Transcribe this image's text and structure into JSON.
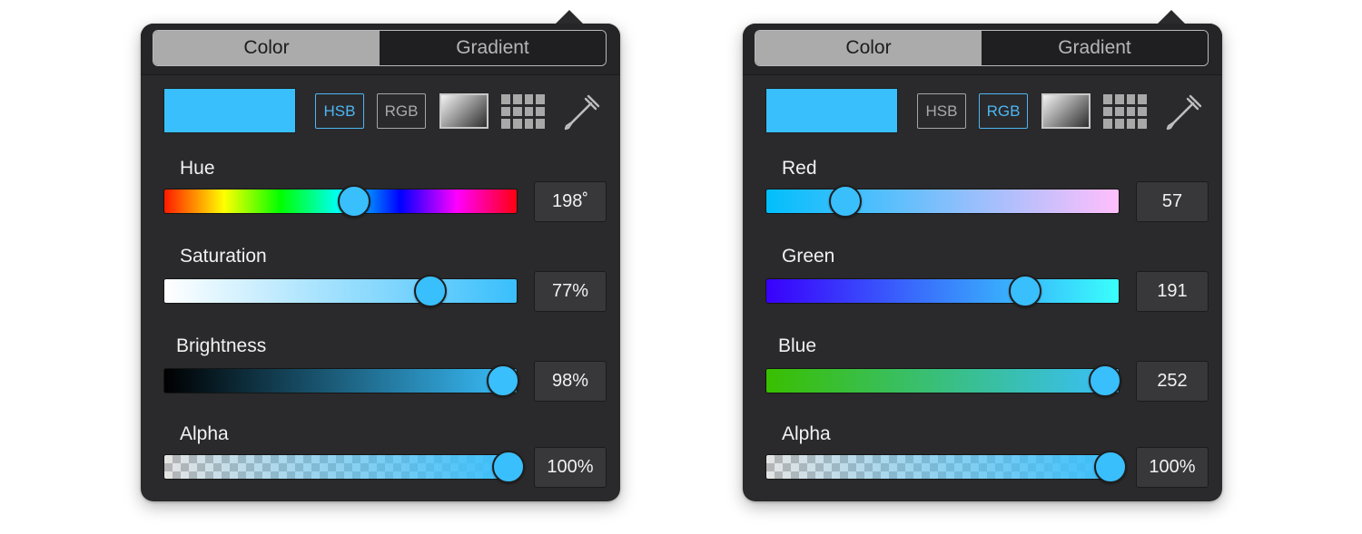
{
  "colors": {
    "accent": "#39bffc",
    "panel_bg": "#2a2a2c",
    "active_mode": "#4db6f3"
  },
  "panels": [
    {
      "tabs": {
        "color": "Color",
        "gradient": "Gradient"
      },
      "selected_tab": "Color",
      "modes": {
        "hsb": "HSB",
        "rgb": "RGB"
      },
      "active_mode": "HSB",
      "icons": {
        "gradient": "gradient-preset-icon",
        "grid": "swatch-grid-icon",
        "eyedropper": "eyedropper-icon"
      },
      "sliders": [
        {
          "label": "Hue",
          "value": "198˚",
          "level": 0.55
        },
        {
          "label": "Saturation",
          "value": "77%",
          "level": 0.77
        },
        {
          "label": "Brightness",
          "value": "98%",
          "level": 0.98
        },
        {
          "label": "Alpha",
          "value": "100%",
          "level": 1.0
        }
      ]
    },
    {
      "tabs": {
        "color": "Color",
        "gradient": "Gradient"
      },
      "selected_tab": "Color",
      "modes": {
        "hsb": "HSB",
        "rgb": "RGB"
      },
      "active_mode": "RGB",
      "icons": {
        "gradient": "gradient-preset-icon",
        "grid": "swatch-grid-icon",
        "eyedropper": "eyedropper-icon"
      },
      "sliders": [
        {
          "label": "Red",
          "value": "57",
          "level": 0.224
        },
        {
          "label": "Green",
          "value": "191",
          "level": 0.749
        },
        {
          "label": "Blue",
          "value": "252",
          "level": 0.988
        },
        {
          "label": "Alpha",
          "value": "100%",
          "level": 1.0
        }
      ]
    }
  ]
}
